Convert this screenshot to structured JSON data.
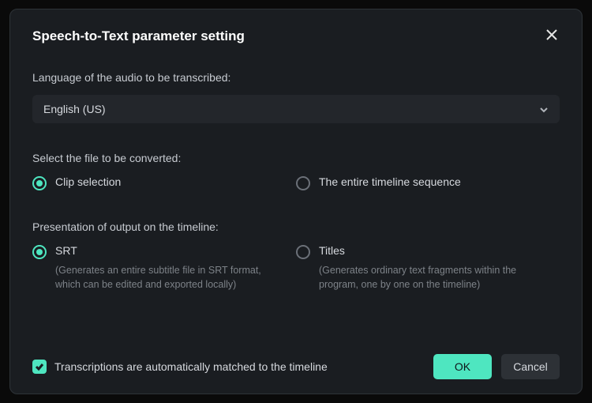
{
  "dialog": {
    "title": "Speech-to-Text parameter setting"
  },
  "language": {
    "label": "Language of the audio to be transcribed:",
    "selected": "English (US)"
  },
  "fileSelect": {
    "label": "Select the file to be converted:",
    "options": {
      "clip": "Clip selection",
      "timeline": "The entire timeline sequence"
    }
  },
  "output": {
    "label": "Presentation of output on the timeline:",
    "srt": {
      "label": "SRT",
      "desc": "(Generates an entire subtitle file in SRT format, which can be edited and exported locally)"
    },
    "titles": {
      "label": "Titles",
      "desc": "(Generates ordinary text fragments within the program, one by one on the timeline)"
    }
  },
  "autoMatch": {
    "label": "Transcriptions are automatically matched to the timeline"
  },
  "buttons": {
    "ok": "OK",
    "cancel": "Cancel"
  }
}
